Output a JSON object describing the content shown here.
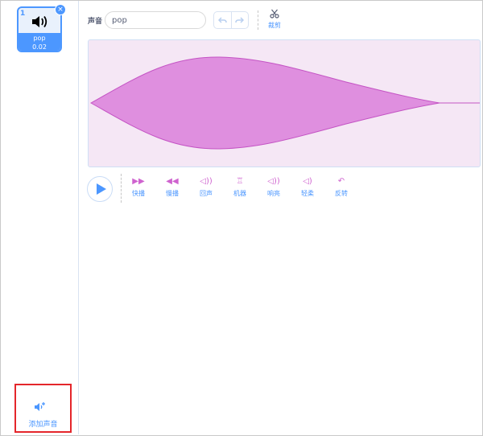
{
  "sound_list": {
    "selected": {
      "number": "1",
      "name": "pop",
      "duration": "0.02",
      "icon": "speaker-icon"
    },
    "delete_label": "×",
    "add_sound_label": "添加声音"
  },
  "editor": {
    "name_label": "声音",
    "name_value": "pop",
    "trim_label": "裁剪",
    "effects": [
      {
        "label": "快播",
        "icon": "faster-icon",
        "glyph": "▶▶"
      },
      {
        "label": "慢播",
        "icon": "slower-icon",
        "glyph": "◀◀"
      },
      {
        "label": "回声",
        "icon": "echo-icon",
        "glyph": "◁))"
      },
      {
        "label": "机器",
        "icon": "robot-icon",
        "glyph": "♖"
      },
      {
        "label": "响亮",
        "icon": "louder-icon",
        "glyph": "◁))"
      },
      {
        "label": "轻柔",
        "icon": "softer-icon",
        "glyph": "◁)"
      },
      {
        "label": "反转",
        "icon": "reverse-icon",
        "glyph": "↶"
      }
    ]
  },
  "colors": {
    "accent": "#4c97ff",
    "waveform_fill": "#df8fdf",
    "waveform_stroke": "#c454c4",
    "waveform_bg": "#f5e7f5",
    "effect_icon": "#cf63cf",
    "highlight_box": "#e4262b"
  }
}
